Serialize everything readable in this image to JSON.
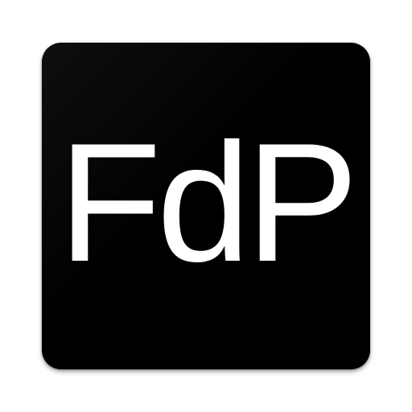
{
  "app_icon": {
    "monogram": "FdP",
    "background_color": "#000000",
    "text_color": "#ffffff"
  }
}
